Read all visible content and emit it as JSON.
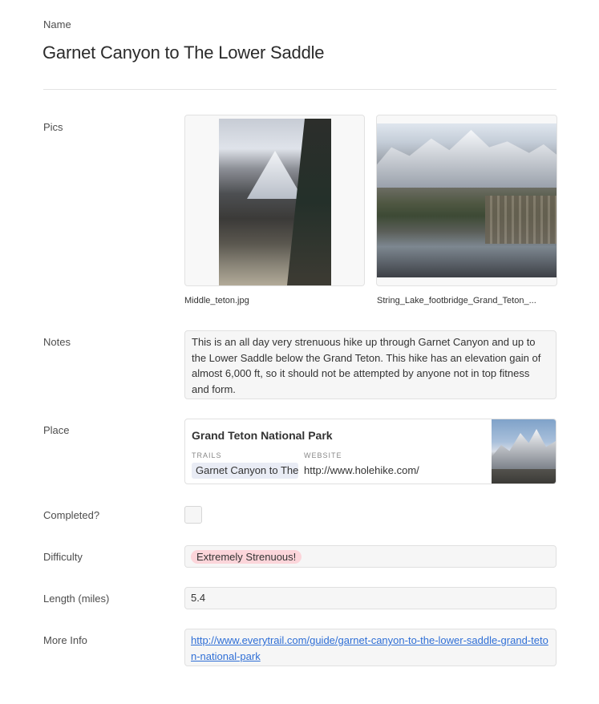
{
  "name": {
    "label": "Name",
    "value": "Garnet Canyon to The Lower Saddle"
  },
  "pics": {
    "label": "Pics",
    "items": [
      {
        "filename": "Middle_teton.jpg"
      },
      {
        "filename": "String_Lake_footbridge_Grand_Teton_..."
      }
    ]
  },
  "notes": {
    "label": "Notes",
    "value": "This is an all day very strenuous hike up through Garnet Canyon and up to the Lower Saddle below the Grand Teton. This hike has an elevation gain of almost 6,000 ft, so it should not be attempted by anyone not in top fitness and form."
  },
  "place": {
    "label": "Place",
    "title": "Grand Teton National Park",
    "trails_heading": "TRAILS",
    "trail_chip": "Garnet Canyon to The Lower Saddle",
    "website_heading": "WEBSITE",
    "website": "http://www.holehike.com/"
  },
  "completed": {
    "label": "Completed?",
    "checked": false
  },
  "difficulty": {
    "label": "Difficulty",
    "value": "Extremely Strenuous!",
    "color": "#fcd5da"
  },
  "length": {
    "label": "Length (miles)",
    "value": "5.4"
  },
  "more_info": {
    "label": "More Info",
    "url": "http://www.everytrail.com/guide/garnet-canyon-to-the-lower-saddle-grand-teton-national-park"
  },
  "colors": {
    "link": "#2f6fd6",
    "field_bg": "#f6f6f6",
    "chip_bg": "#e9ecf5"
  }
}
